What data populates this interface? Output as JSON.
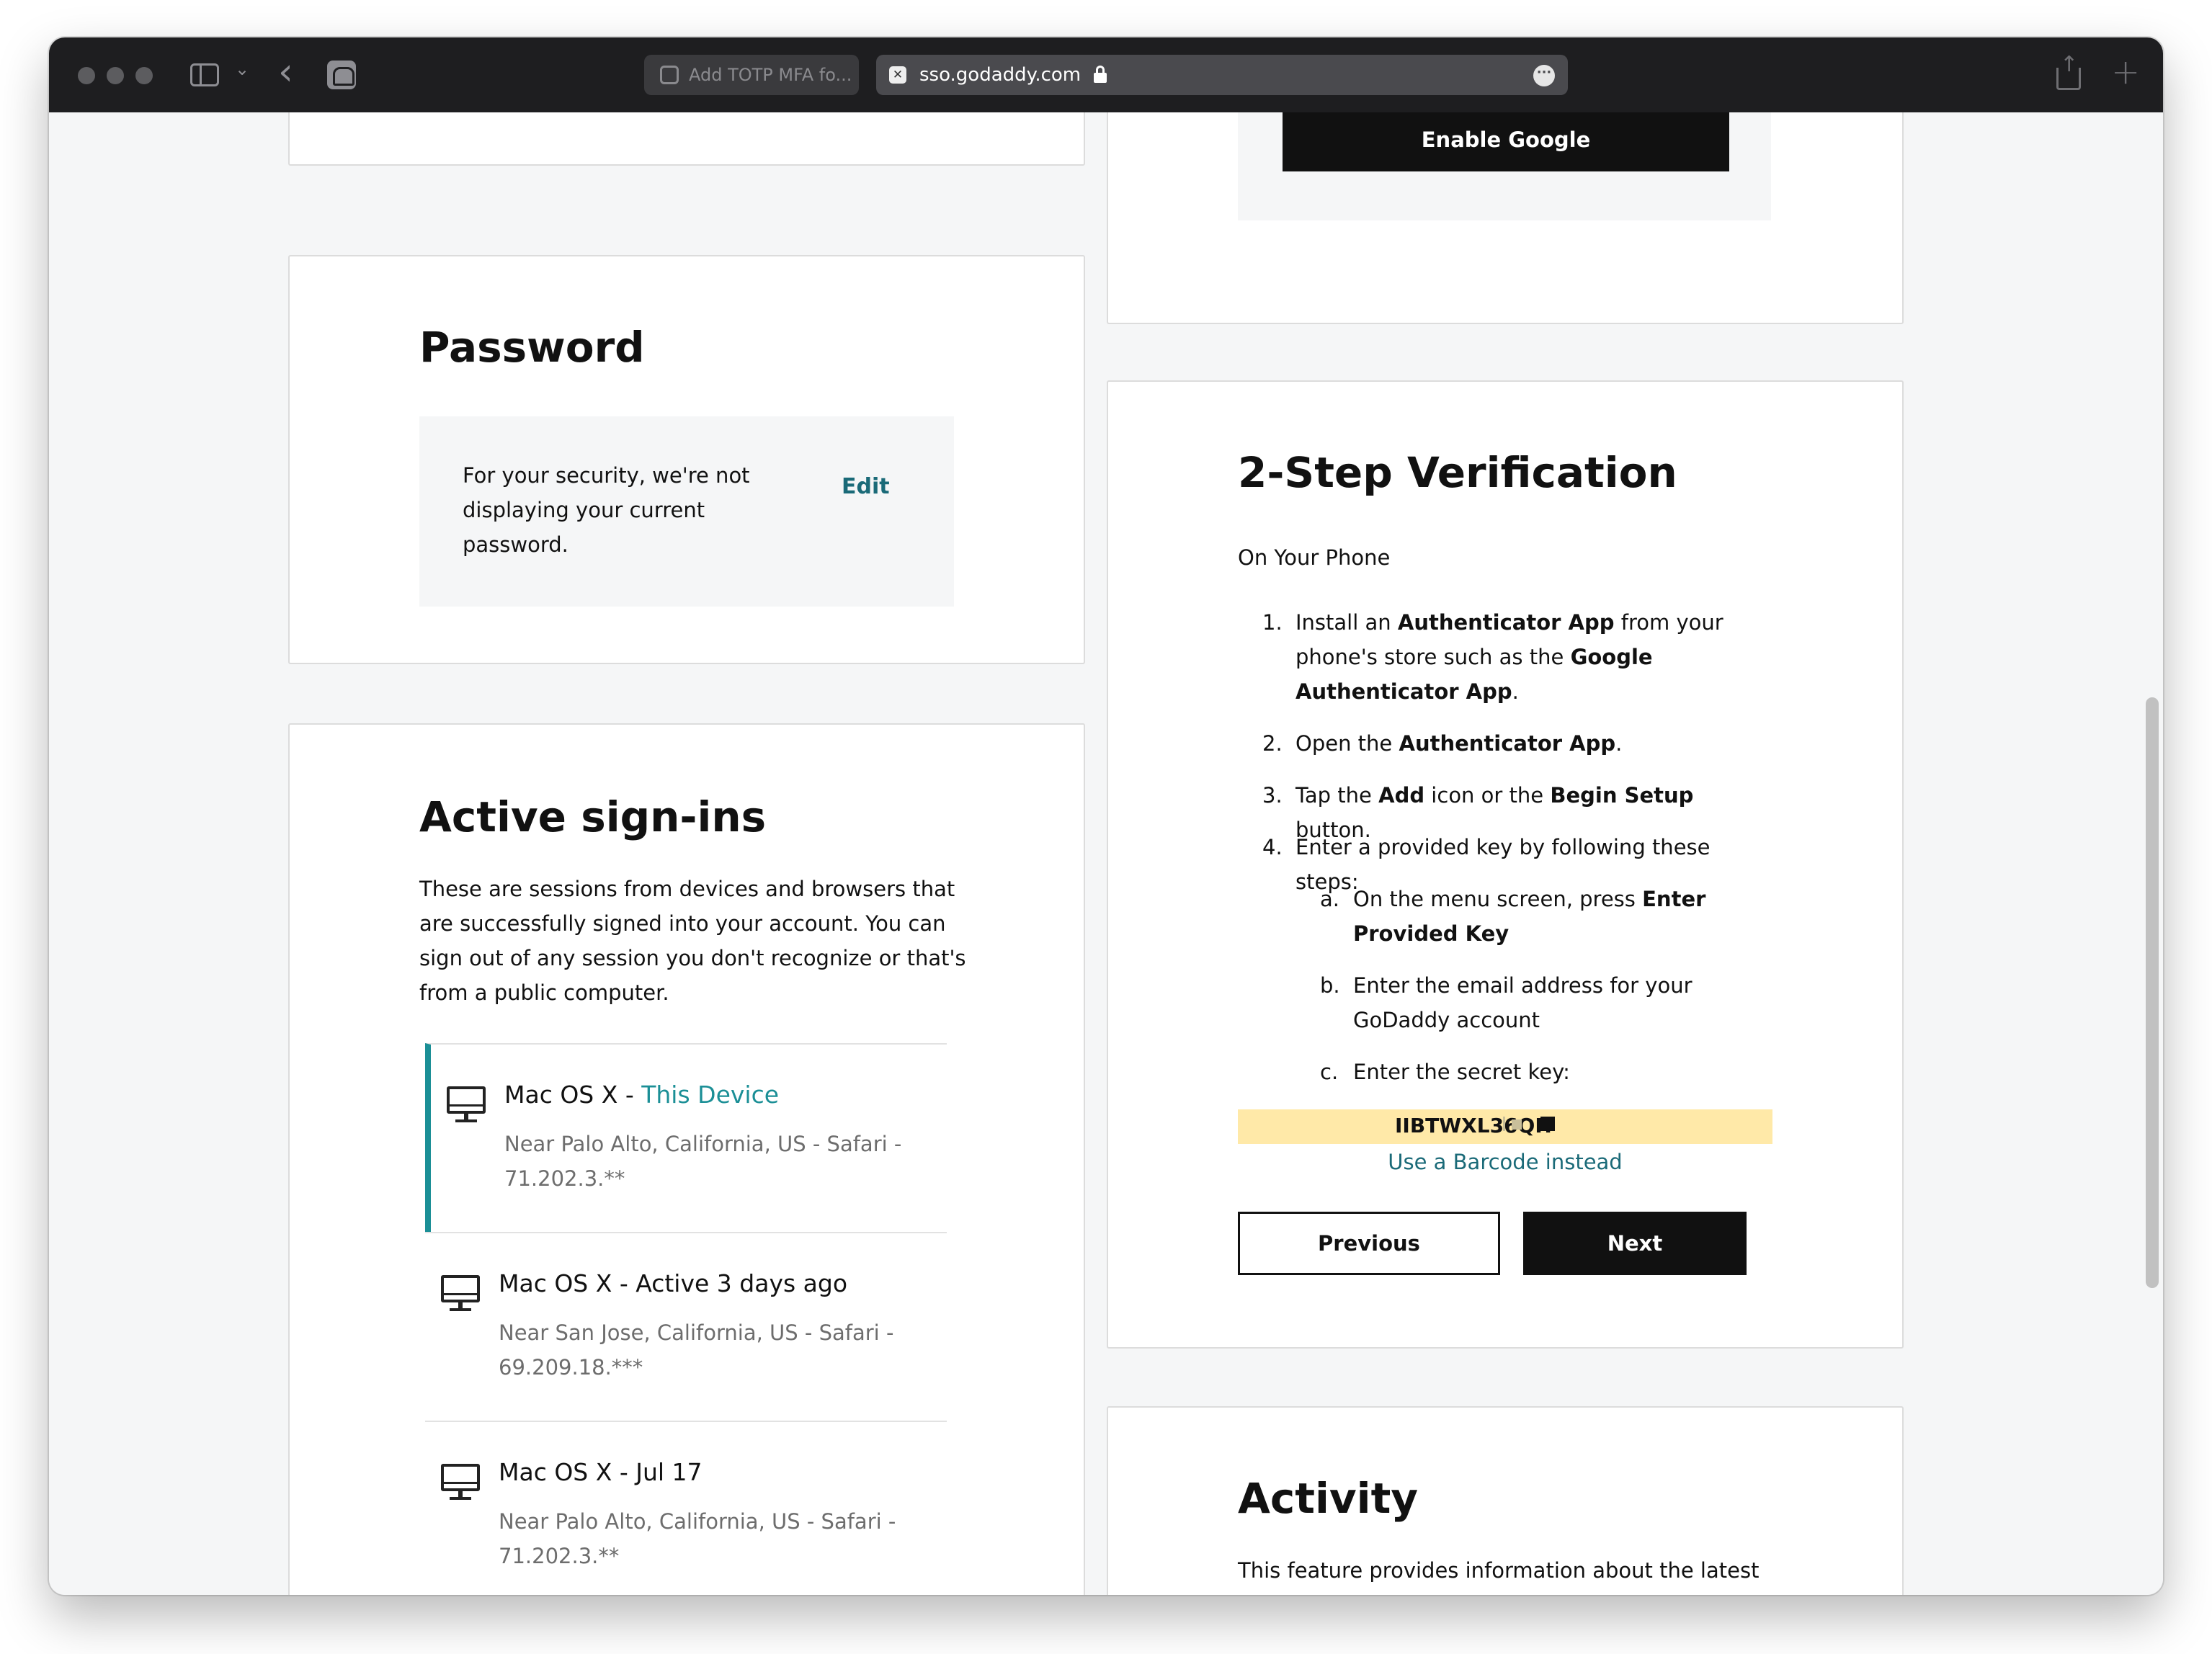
{
  "browser": {
    "inactive_tab_title": "Add TOTP MFA fo...",
    "active_tab_url": "sso.godaddy.com",
    "active_tab_favicon": "✕"
  },
  "password_card": {
    "title": "Password",
    "message": "For your security, we're not displaying your current password.",
    "edit_label": "Edit"
  },
  "active_signins": {
    "title": "Active sign-ins",
    "description": "These are sessions from devices and browsers that are successfully signed into your account. You can sign out of any session you don't recognize or that's from a public computer.",
    "sessions": [
      {
        "device": "Mac OS X - ",
        "status": "This Device",
        "meta": "Near Palo Alto, California, US - Safari - 71.202.3.**"
      },
      {
        "device": "Mac OS X - Active 3 days ago",
        "status": "",
        "meta": "Near San Jose, California, US - Safari - 69.209.18.***"
      },
      {
        "device": "Mac OS X - Jul 17",
        "status": "",
        "meta": "Near Palo Alto, California, US - Safari - 71.202.3.**"
      }
    ]
  },
  "google_card": {
    "button_label": "Enable Google"
  },
  "two_step": {
    "title": "2-Step Verification",
    "subtitle": "On Your Phone",
    "steps": {
      "s1": {
        "num": "1.",
        "a": "Install an ",
        "b": "Authenticator App",
        "c": " from your phone's store such as the ",
        "d": "Google Authenticator App",
        "e": "."
      },
      "s2": {
        "num": "2.",
        "a": "Open the ",
        "b": "Authenticator App",
        "c": "."
      },
      "s3": {
        "num": "3.",
        "a": "Tap the ",
        "b": "Add",
        "c": " icon or the ",
        "d": "Begin Setup",
        "e": " button."
      },
      "s4": {
        "num": "4.",
        "a": "Enter a provided key by following these steps:"
      },
      "sa": {
        "num": "a.",
        "a": "On the menu screen, press ",
        "b": "Enter Provided Key"
      },
      "sb": {
        "num": "b.",
        "a": "Enter the email address for your GoDaddy account"
      },
      "sc": {
        "num": "c.",
        "a": "Enter the secret key:"
      }
    },
    "secret_key": "IIBTWXL36QH",
    "barcode_link": "Use a Barcode instead",
    "previous_label": "Previous",
    "next_label": "Next"
  },
  "activity": {
    "title": "Activity",
    "description": "This feature provides information about the latest activity on this account that affects your account"
  }
}
